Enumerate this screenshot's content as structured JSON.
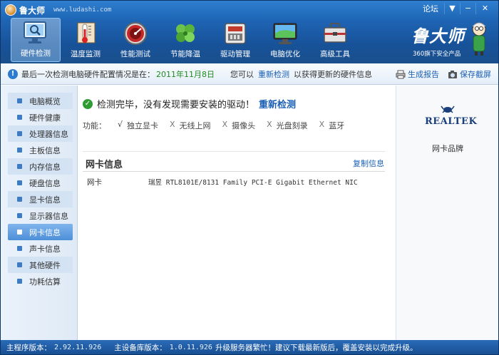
{
  "app": {
    "name": "鲁大师",
    "url": "www.ludashi.com",
    "forum_label": "论坛",
    "menu_btn": "▼",
    "min_btn": "−",
    "close_btn": "✕"
  },
  "toolbar": [
    {
      "label": "硬件检测",
      "icon": "monitor-magnifier-icon",
      "active": true
    },
    {
      "label": "温度监测",
      "icon": "thermometer-icon",
      "active": false
    },
    {
      "label": "性能测试",
      "icon": "speedometer-icon",
      "active": false
    },
    {
      "label": "节能降温",
      "icon": "clover-icon",
      "active": false
    },
    {
      "label": "驱动管理",
      "icon": "driver-box-icon",
      "active": false
    },
    {
      "label": "电脑优化",
      "icon": "monitor-optimize-icon",
      "active": false
    },
    {
      "label": "高级工具",
      "icon": "toolbox-icon",
      "active": false
    }
  ],
  "brand": {
    "name": "鲁大师",
    "subtitle": "360旗下安全产品"
  },
  "infobar": {
    "prefix": "最后一次检测电脑硬件配置情况是在：",
    "date": "2011年11月8日",
    "middle": "您可以",
    "link": "重新检测",
    "suffix": "以获得更新的硬件信息",
    "report_label": "生成报告",
    "screenshot_label": "保存截屏"
  },
  "sidebar": {
    "items": [
      {
        "label": "电脑概览",
        "active": false
      },
      {
        "label": "硬件健康",
        "active": false
      },
      {
        "label": "处理器信息",
        "active": false
      },
      {
        "label": "主板信息",
        "active": false
      },
      {
        "label": "内存信息",
        "active": false
      },
      {
        "label": "硬盘信息",
        "active": false
      },
      {
        "label": "显卡信息",
        "active": false
      },
      {
        "label": "显示器信息",
        "active": false
      },
      {
        "label": "网卡信息",
        "active": true
      },
      {
        "label": "声卡信息",
        "active": false
      },
      {
        "label": "其他硬件",
        "active": false
      },
      {
        "label": "功耗估算",
        "active": false
      }
    ]
  },
  "main": {
    "result_text": "检测完毕，没有发现需要安装的驱动！",
    "redetect_label": "重新检测",
    "funcs_label": "功能：",
    "funcs": [
      {
        "mark": "√",
        "label": "独立显卡",
        "ok": true
      },
      {
        "mark": "X",
        "label": "无线上网",
        "ok": false
      },
      {
        "mark": "X",
        "label": "摄像头",
        "ok": false
      },
      {
        "mark": "X",
        "label": "光盘刻录",
        "ok": false
      },
      {
        "mark": "X",
        "label": "蓝牙",
        "ok": false
      }
    ],
    "section_title": "网卡信息",
    "copy_label": "复制信息",
    "rows": [
      {
        "key": "网卡",
        "value": "瑞昱 RTL8101E/8131 Family PCI-E Gigabit Ethernet NIC"
      }
    ]
  },
  "rightpanel": {
    "brand_logo_text": "REALTEK",
    "brand_label": "网卡品牌"
  },
  "statusbar": {
    "main_version_label": "主程序版本：",
    "main_version": "2.92.11.926",
    "db_version_label": "主设备库版本：",
    "db_version": "1.0.11.926",
    "message": "升级服务器繁忙！建议下载最新版后，覆盖安装以完成升级。"
  },
  "colors": {
    "header": "#1f65b5",
    "link": "#1b5fb4",
    "success": "#2e9b33",
    "date": "#1f8a1f"
  }
}
